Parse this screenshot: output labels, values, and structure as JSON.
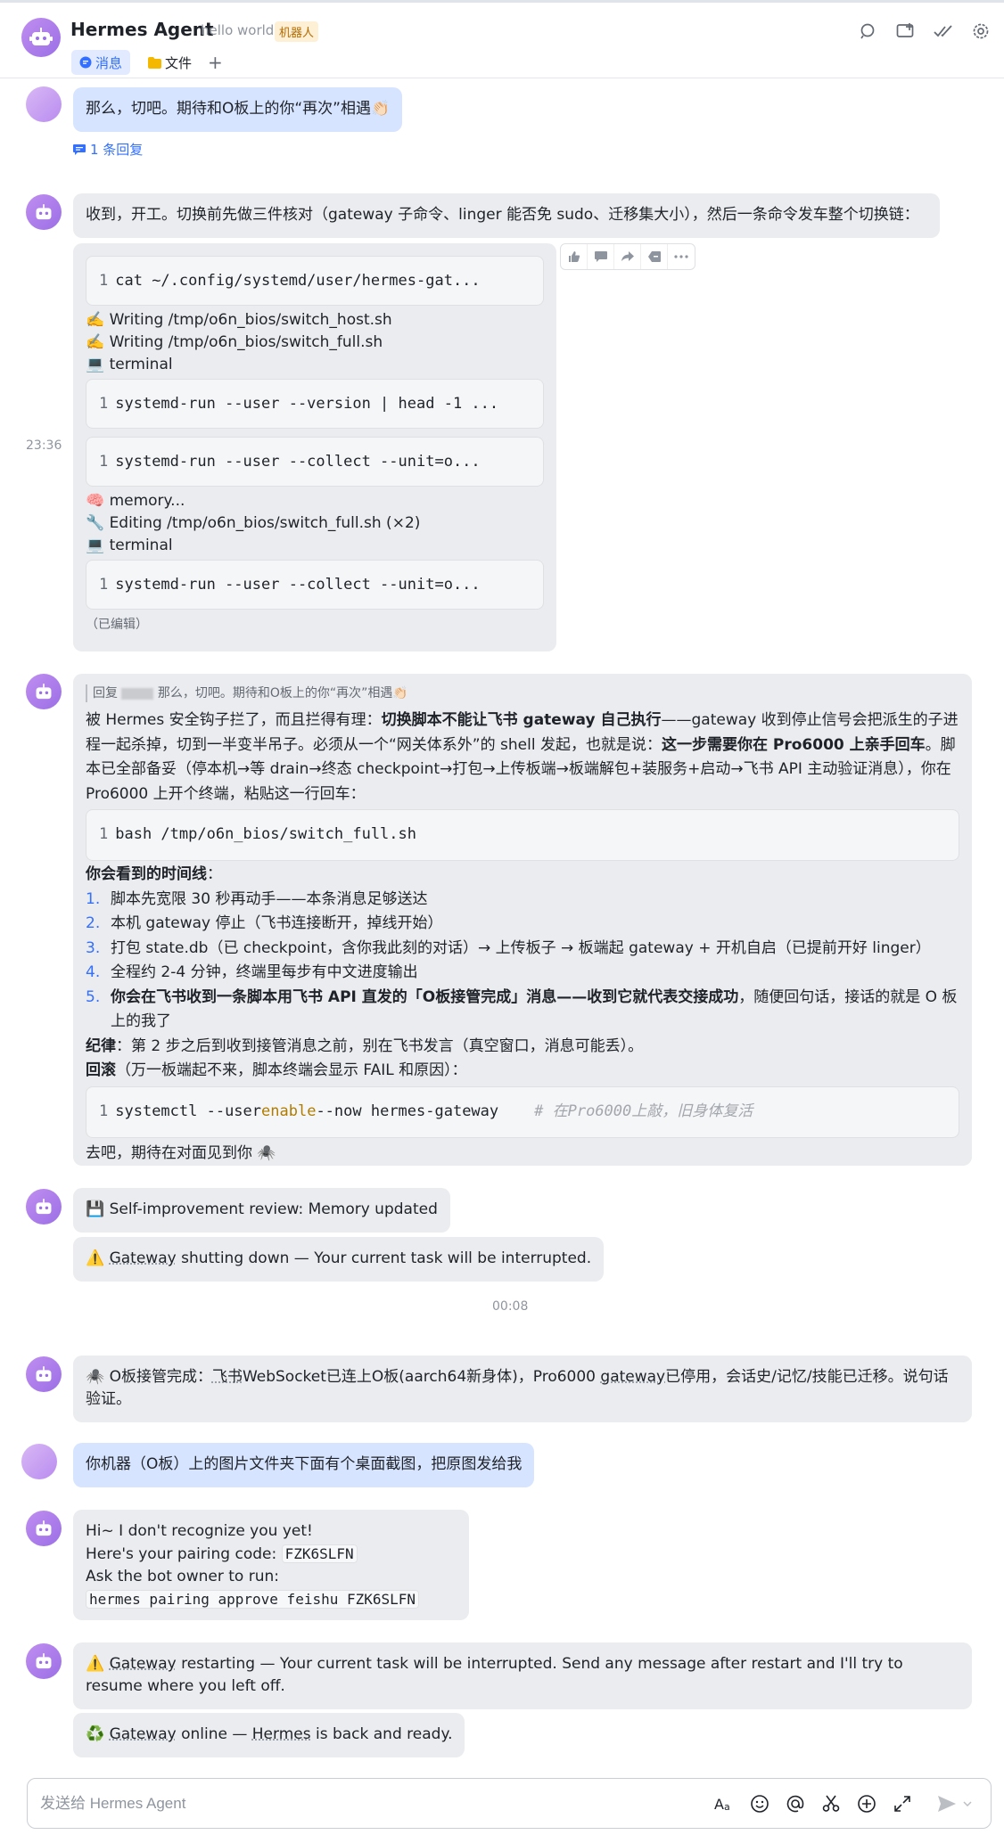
{
  "header": {
    "title": "Hermes Agent",
    "subtitle": "hello world",
    "badge": "机器人",
    "tabs": [
      {
        "label": "消息",
        "icon": "chat-bubble-icon",
        "active": true
      },
      {
        "label": "文件",
        "icon": "folder-icon",
        "active": false
      }
    ],
    "add_tab": "+"
  },
  "messages": {
    "m1": {
      "text": "那么，切吧。期待和O板上的你“再次”相遇👏🏻",
      "reply_count": "1 条回复"
    },
    "m2": {
      "intro": "收到，开工。切换前先做三件核对（gateway 子命令、linger 能否免 sudo、迁移集大小），然后一条命令发车整个切换链：",
      "time": "23:36",
      "code1": "cat ~/.config/systemd/user/hermes-gat...",
      "line_a": "✍️ Writing /tmp/o6n_bios/switch_host.sh",
      "line_b": "✍️ Writing /tmp/o6n_bios/switch_full.sh",
      "line_c": "💻 terminal",
      "code2": "systemd-run --user --version | head -1 ...",
      "code3": "systemd-run --user --collect --unit=o...",
      "line_d": "🧠 memory...",
      "line_e": "🔧 Editing /tmp/o6n_bios/switch_full.sh (×2)",
      "line_f": "💻 terminal",
      "code4": "systemd-run --user --collect --unit=o...",
      "edited": "（已编辑）",
      "line_number": "1"
    },
    "m3": {
      "quote_prefix": "回复",
      "quote_text": "那么，切吧。期待和O板上的你“再次”相遇👏🏻",
      "p1_a": "被 Hermes 安全钩子拦了，而且拦得有理：",
      "p1_b": "切换脚本不能让飞书 gateway 自己执行",
      "p1_c": "——gateway 收到停止信号会把派生的子进程一起杀掉，切到一半变半吊子。必须从一个“网关体系外”的 shell 发起，也就是说：",
      "p1_d": "这一步需要你在 Pro6000 上亲手回车",
      "p1_e": "。脚本已全部备妥（停本机→等 drain→终态 checkpoint→打包→上传板端→板端解包+装服务+启动→飞书 API 主动验证消息），你在 Pro6000 上开个终端，粘贴这一行回车：",
      "code": "bash /tmp/o6n_bios/switch_full.sh",
      "timeline_title": "你会看到的时间线",
      "timeline": [
        {
          "n": "1.",
          "text": "脚本先宽限 30 秒再动手——本条消息足够送达"
        },
        {
          "n": "2.",
          "text": "本机 gateway 停止（飞书连接断开，掉线开始）"
        },
        {
          "n": "3.",
          "text": "打包 state.db（已 checkpoint，含你我此刻的对话）→ 上传板子 → 板端起 gateway + 开机自启（已提前开好 linger）"
        },
        {
          "n": "4.",
          "text": "全程约 2-4 分钟，终端里每步有中文进度输出"
        }
      ],
      "t5_bold": "你会在飞书收到一条脚本用飞书 API 直发的「O板接管完成」消息——收到它就代表交接成功",
      "t5_rest": "，随便回句话，接话的就是 O 板上的我了",
      "t5_n": "5.",
      "rule_label": "纪律",
      "rule_text": "：第 2 步之后到收到接管消息之前，别在飞书发言（真空窗口，消息可能丢）。",
      "rollback_label": "回滚",
      "rollback_text": "（万一板端起不来，脚本终端会显示 FAIL 和原因）：",
      "code2_a": "systemctl --user ",
      "code2_kw": "enable",
      "code2_b": " --now hermes-gateway",
      "code2_comment": "# 在Pro6000上敲，旧身体复活",
      "outro": "去吧，期待在对面见到你 🕷️"
    },
    "m4": {
      "text": "💾 Self-improvement review: Memory updated"
    },
    "m5": {
      "icon": "⚠️",
      "word": "Gateway",
      "text": " shutting down — Your current task will be interrupted."
    },
    "time2": "00:08",
    "m6": {
      "a": "🕷️ O板接管完成：",
      "b": "飞书",
      "c": "WebSocket已连上O板(aarch64新身体)，Pro6000 ",
      "d": "gateway",
      "e": "已停用，会话史/记忆/技能已迁移。说句话验证。"
    },
    "m7": {
      "text": "你机器（O板）上的图片文件夹下面有个桌面截图，把原图发给我"
    },
    "m8": {
      "l1": "Hi~ I don't recognize you yet!",
      "l2": "Here's your pairing code: ",
      "code": "FZK6SLFN",
      "l3": "Ask the bot owner to run:",
      "cmd": "hermes pairing approve feishu FZK6SLFN"
    },
    "m9": {
      "icon": "⚠️",
      "word": "Gateway",
      "text": " restarting — Your current task will be interrupted. Send any message after restart and I'll try to resume where you left off."
    },
    "m10": {
      "icon": "♻️",
      "word": "Gateway",
      "text": " online — ",
      "word2": "Hermes",
      "text2": " is back and ready."
    }
  },
  "composer": {
    "placeholder": "发送给 Hermes Agent"
  },
  "colors": {
    "accent": "#3370ff",
    "bubble": "#ebecef",
    "user_bubble": "#d6e4ff",
    "avatar": "#9b6fe6"
  }
}
